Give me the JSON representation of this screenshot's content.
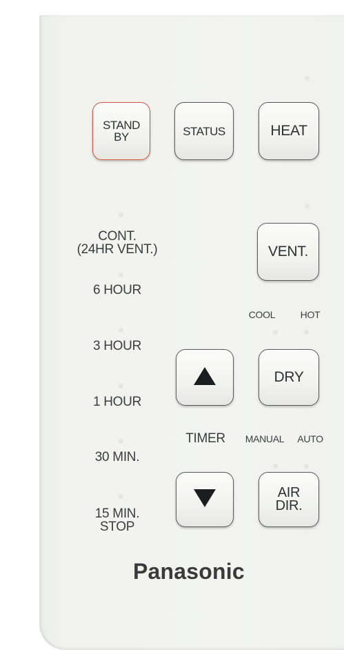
{
  "buttons": {
    "standby": [
      "STAND",
      "BY"
    ],
    "status": "STATUS",
    "heat": "HEAT",
    "vent": "VENT.",
    "dry": "DRY",
    "air_dir": [
      "AIR",
      "DIR."
    ]
  },
  "labels": {
    "cont": [
      "CONT.",
      "(24HR VENT.)"
    ],
    "six_hour": "6 HOUR",
    "three_hour": "3 HOUR",
    "one_hour": "1 HOUR",
    "thirty_min": "30 MIN.",
    "fifteen_min": [
      "15 MIN.",
      "STOP"
    ],
    "timer": "TIMER",
    "cool": "COOL",
    "hot": "HOT",
    "manual": "MANUAL",
    "auto": "AUTO"
  },
  "brand": "Panasonic",
  "colors": {
    "standby_border": "#d2543f",
    "button_border": "#55575a",
    "text": "#3a3c40",
    "body": "#f1f2ee"
  },
  "icons": {
    "up": "triangle-up",
    "down": "triangle-down"
  }
}
